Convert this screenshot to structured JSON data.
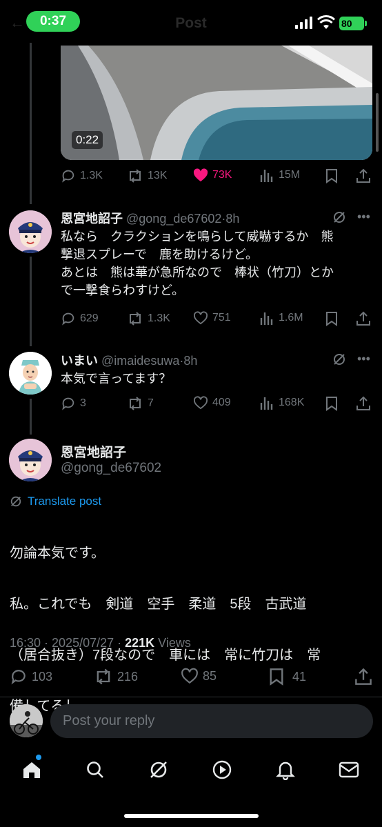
{
  "status_bar": {
    "time": "0:37",
    "battery": "80"
  },
  "header": {
    "title": "Post"
  },
  "video": {
    "duration": "0:22"
  },
  "video_actions": {
    "replies": "1.3K",
    "reposts": "13K",
    "likes": "73K",
    "views": "15M"
  },
  "reply1": {
    "name": "恩宮地詔子",
    "handle": "@gong_de67602",
    "time": "8h",
    "lines": [
      "私なら　クラクションを鳴らして威嚇するか　熊",
      "撃退スプレーで　鹿を助けるけど。",
      "あとは　熊は華が急所なので　棒状（竹刀）とか",
      "で一撃食らわすけど。"
    ],
    "replies": "629",
    "reposts": "1.3K",
    "likes": "751",
    "views": "1.6M"
  },
  "reply2": {
    "name": "いまい",
    "handle": "@imaidesuwa",
    "time": "8h",
    "text": "本気で言ってます？",
    "replies": "3",
    "reposts": "7",
    "likes": "409",
    "views": "168K"
  },
  "main": {
    "name": "恩宮地詔子",
    "handle": "@gong_de67602",
    "translate": "Translate post",
    "lines": [
      "勿論本気です。",
      "私。これでも　剣道　空手　柔道　5段　古武道",
      "（居合抜き）7段なので　車には　常に竹刀は　常",
      "備してるし。"
    ],
    "time": "16:30 · 2025/07/27 · ",
    "views_count": "221K",
    "views_label": " Views",
    "replies": "103",
    "reposts": "216",
    "likes": "85",
    "bookmarks": "41"
  },
  "composer": {
    "placeholder": "Post your reply"
  },
  "colors": {
    "accent": "#1d9bf0",
    "like": "#f91880",
    "muted": "#71767b",
    "battery": "#30d158"
  }
}
